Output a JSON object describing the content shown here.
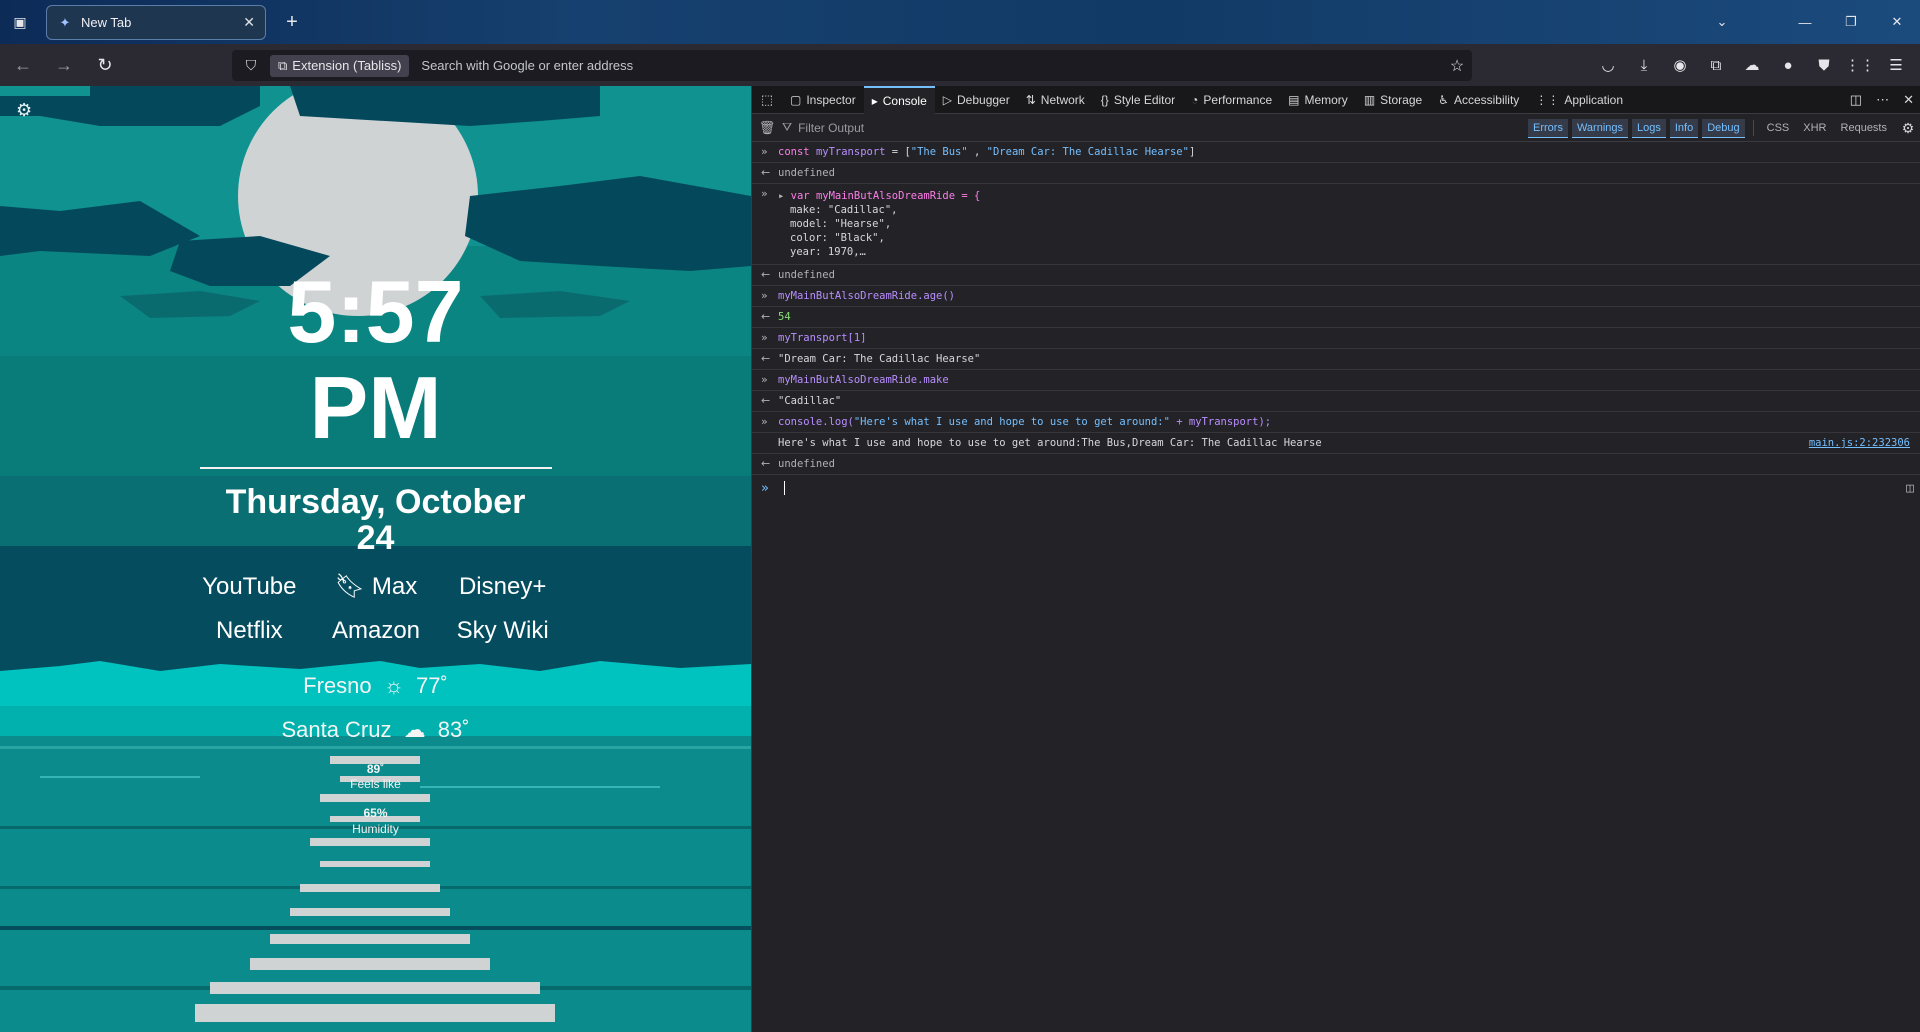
{
  "browser": {
    "tab_title": "New Tab",
    "urlbar": {
      "extension_chip": "Extension (Tabliss)",
      "placeholder": "Search with Google or enter address"
    }
  },
  "tabliss": {
    "time_line1": "5:57",
    "time_line2": "PM",
    "date_line1": "Thursday, October",
    "date_line2": "24",
    "links": [
      "YouTube",
      "Max",
      "Disney+",
      "Netflix",
      "Amazon",
      "Sky Wiki"
    ],
    "weather": [
      {
        "city": "Fresno",
        "icon": "sun-icon",
        "temp": "77˚"
      },
      {
        "city": "Santa Cruz",
        "icon": "cloud-icon",
        "temp": "83˚"
      }
    ],
    "feels_like_value": "89˚",
    "feels_like_label": "Feels like",
    "humidity_value": "65%",
    "humidity_label": "Humidity"
  },
  "devtools": {
    "tabs": [
      "Inspector",
      "Console",
      "Debugger",
      "Network",
      "Style Editor",
      "Performance",
      "Memory",
      "Storage",
      "Accessibility",
      "Application"
    ],
    "active_tab": "Console",
    "filter_placeholder": "Filter Output",
    "levels": [
      "Errors",
      "Warnings",
      "Logs",
      "Info",
      "Debug"
    ],
    "extra_filters": [
      "CSS",
      "XHR",
      "Requests"
    ],
    "console": {
      "l1_pre": "const ",
      "l1_var": "myTransport",
      "l1_eq": " = [",
      "l1_s1": "\"The Bus\"",
      "l1_mid": " , ",
      "l1_s2": "\"Dream Car: The Cadillac Hearse\"",
      "l1_end": "]",
      "undefined": "undefined",
      "l2_head": "var myMainButAlsoDreamRide = {",
      "l2_make": "make: \"Cadillac\",",
      "l2_model": "model: \"Hearse\",",
      "l2_color": "color: \"Black\",",
      "l2_year": "year: 1970,…",
      "l3_in": "myMainButAlsoDreamRide.age()",
      "l3_out": "54",
      "l4_in": "myTransport[1]",
      "l4_out": "\"Dream Car: The Cadillac Hearse\"",
      "l5_in": "myMainButAlsoDreamRide.make",
      "l5_out": "\"Cadillac\"",
      "l6_in_a": "console.log(",
      "l6_in_str": "\"Here's what I use and hope to use to get around:\"",
      "l6_in_b": " + myTransport);",
      "l6_log": "Here's what I use and hope to use to get around:The Bus,Dream Car: The Cadillac Hearse",
      "l6_loc": "main.js:2:232306"
    }
  },
  "colors": {
    "accent": "#75bfff",
    "page_bg": "#0d8a88",
    "sea_light": "#00c9c6"
  }
}
